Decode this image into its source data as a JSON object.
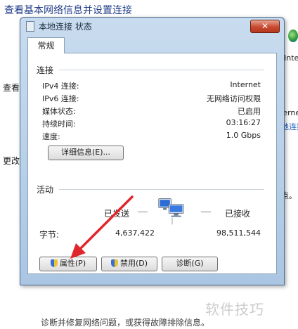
{
  "background": {
    "title": "查看基本网络信息并设置连接",
    "left_labels": [
      "查看",
      "更改"
    ],
    "right_labels": [
      "Inte",
      "ternet",
      "地连接",
      "点。"
    ],
    "bottom_text": "诊断并修复网络问题，或获得故障排除信息。",
    "watermark": "软件技巧"
  },
  "dialog": {
    "title": "本地连接 状态",
    "close_label": "✕",
    "tab": "常规",
    "connection": {
      "section_label": "连接",
      "rows": [
        {
          "label": "IPv4 连接:",
          "value": "Internet"
        },
        {
          "label": "IPv6 连接:",
          "value": "无网络访问权限"
        },
        {
          "label": "媒体状态:",
          "value": "已启用"
        },
        {
          "label": "持续时间:",
          "value": "03:16:27"
        },
        {
          "label": "速度:",
          "value": "1.0 Gbps"
        }
      ],
      "details_button": "详细信息(E)..."
    },
    "activity": {
      "section_label": "活动",
      "sent_label": "已发送",
      "received_label": "已接收",
      "bytes_label": "字节:",
      "bytes_sent": "4,637,422",
      "bytes_received": "98,511,544"
    },
    "buttons": {
      "properties": "属性(P)",
      "disable": "禁用(D)",
      "diagnose": "诊断(G)"
    }
  },
  "colors": {
    "accent_arrow": "#e0262a",
    "title_blue": "#1f3c88"
  }
}
